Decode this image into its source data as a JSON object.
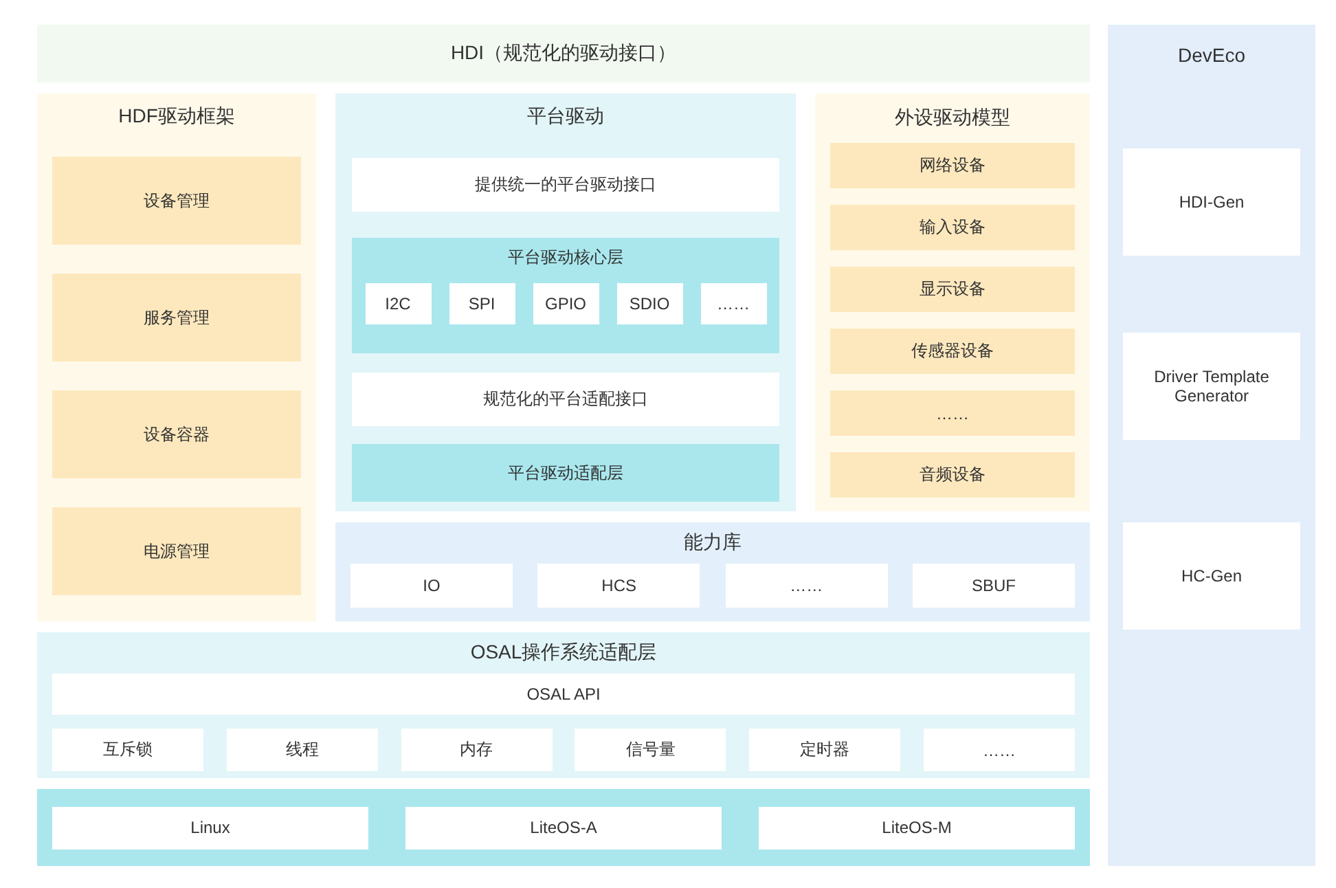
{
  "hdi": {
    "title": "HDI（规范化的驱动接口）"
  },
  "hdf_framework": {
    "title": "HDF驱动框架",
    "items": [
      "设备管理",
      "服务管理",
      "设备容器",
      "电源管理"
    ]
  },
  "platform_driver": {
    "title": "平台驱动",
    "unified_interface": "提供统一的平台驱动接口",
    "core_layer": {
      "title": "平台驱动核心层",
      "items": [
        "I2C",
        "SPI",
        "GPIO",
        "SDIO",
        "……"
      ]
    },
    "adapter_interface": "规范化的平台适配接口",
    "adapter_layer": "平台驱动适配层"
  },
  "peripheral_model": {
    "title": "外设驱动模型",
    "items": [
      "网络设备",
      "输入设备",
      "显示设备",
      "传感器设备",
      "……",
      "音频设备"
    ]
  },
  "capability_library": {
    "title": "能力库",
    "items": [
      "IO",
      "HCS",
      "……",
      "SBUF"
    ]
  },
  "osal": {
    "title": "OSAL操作系统适配层",
    "api": "OSAL API",
    "items": [
      "互斥锁",
      "线程",
      "内存",
      "信号量",
      "定时器",
      "……"
    ]
  },
  "os_layer": {
    "items": [
      "Linux",
      "LiteOS-A",
      "LiteOS-M"
    ]
  },
  "deveco": {
    "title": "DevEco",
    "tools": [
      "HDI-Gen",
      "Driver Template Generator",
      "HC-Gen"
    ]
  }
}
